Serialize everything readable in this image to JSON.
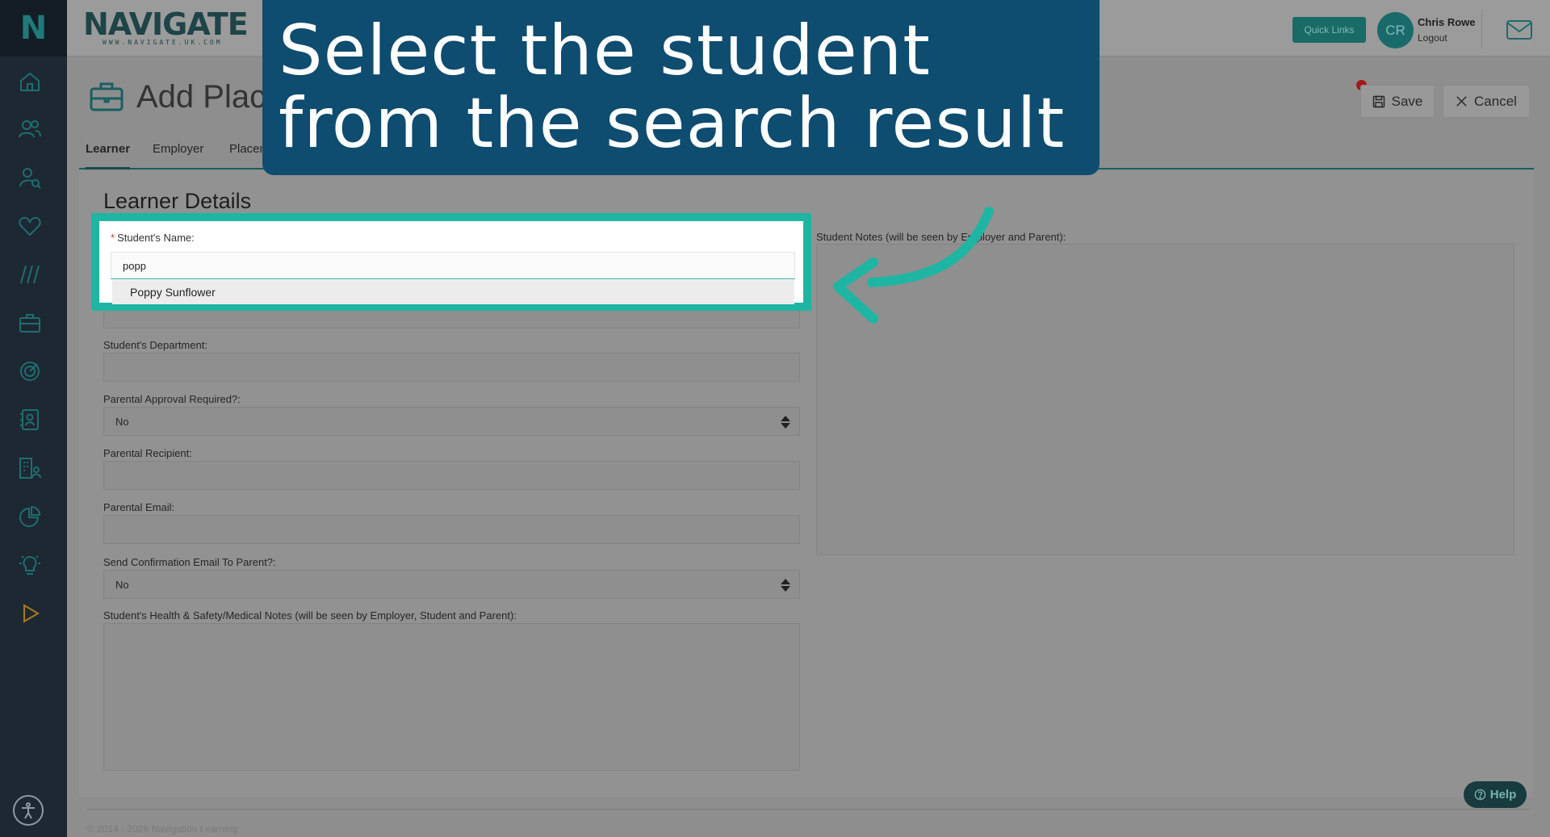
{
  "app": {
    "logo_letter": "N",
    "brand_name": "NAVIGATE",
    "brand_url": "WWW.NAVIGATE.UK.COM"
  },
  "header": {
    "quick_links": "Quick Links",
    "avatar_initials": "CR",
    "user_name": "Chris Rowe",
    "logout": "Logout"
  },
  "sidebar": {
    "items": [
      "home-icon",
      "users-icon",
      "user-search-icon",
      "heart-icon",
      "slashes-icon",
      "briefcase-icon",
      "target-icon",
      "contact-card-icon",
      "building-user-icon",
      "pie-chart-icon",
      "lightbulb-icon",
      "play-icon"
    ],
    "accessibility": "accessibility-icon"
  },
  "page": {
    "title": "Add Placement",
    "save": "Save",
    "cancel": "Cancel"
  },
  "tabs": [
    "Learner",
    "Employer",
    "Placement"
  ],
  "form": {
    "section_title": "Learner Details",
    "students_name_label": "Student's Name:",
    "search_value": "popp",
    "search_result": "Poppy Sunflower",
    "department_label": "Student's Department:",
    "parental_approval_label": "Parental Approval Required?:",
    "parental_approval_value": "No",
    "parental_recipient_label": "Parental Recipient:",
    "parental_email_label": "Parental Email:",
    "send_confirmation_label": "Send Confirmation Email To Parent?:",
    "send_confirmation_value": "No",
    "health_notes_label": "Student's Health & Safety/Medical Notes (will be seen by Employer, Student and Parent):",
    "student_notes_label": "Student Notes (will be seen by Employer and Parent):"
  },
  "footer": {
    "copyright": "© 2014 - 2026 Navigation Learning",
    "help": "Help"
  },
  "overlay": {
    "instruction": "Select the student\nfrom the search result"
  },
  "colors": {
    "highlight": "#1fb5a3",
    "banner": "#0e4c70",
    "brand_teal": "#1a6a66"
  }
}
